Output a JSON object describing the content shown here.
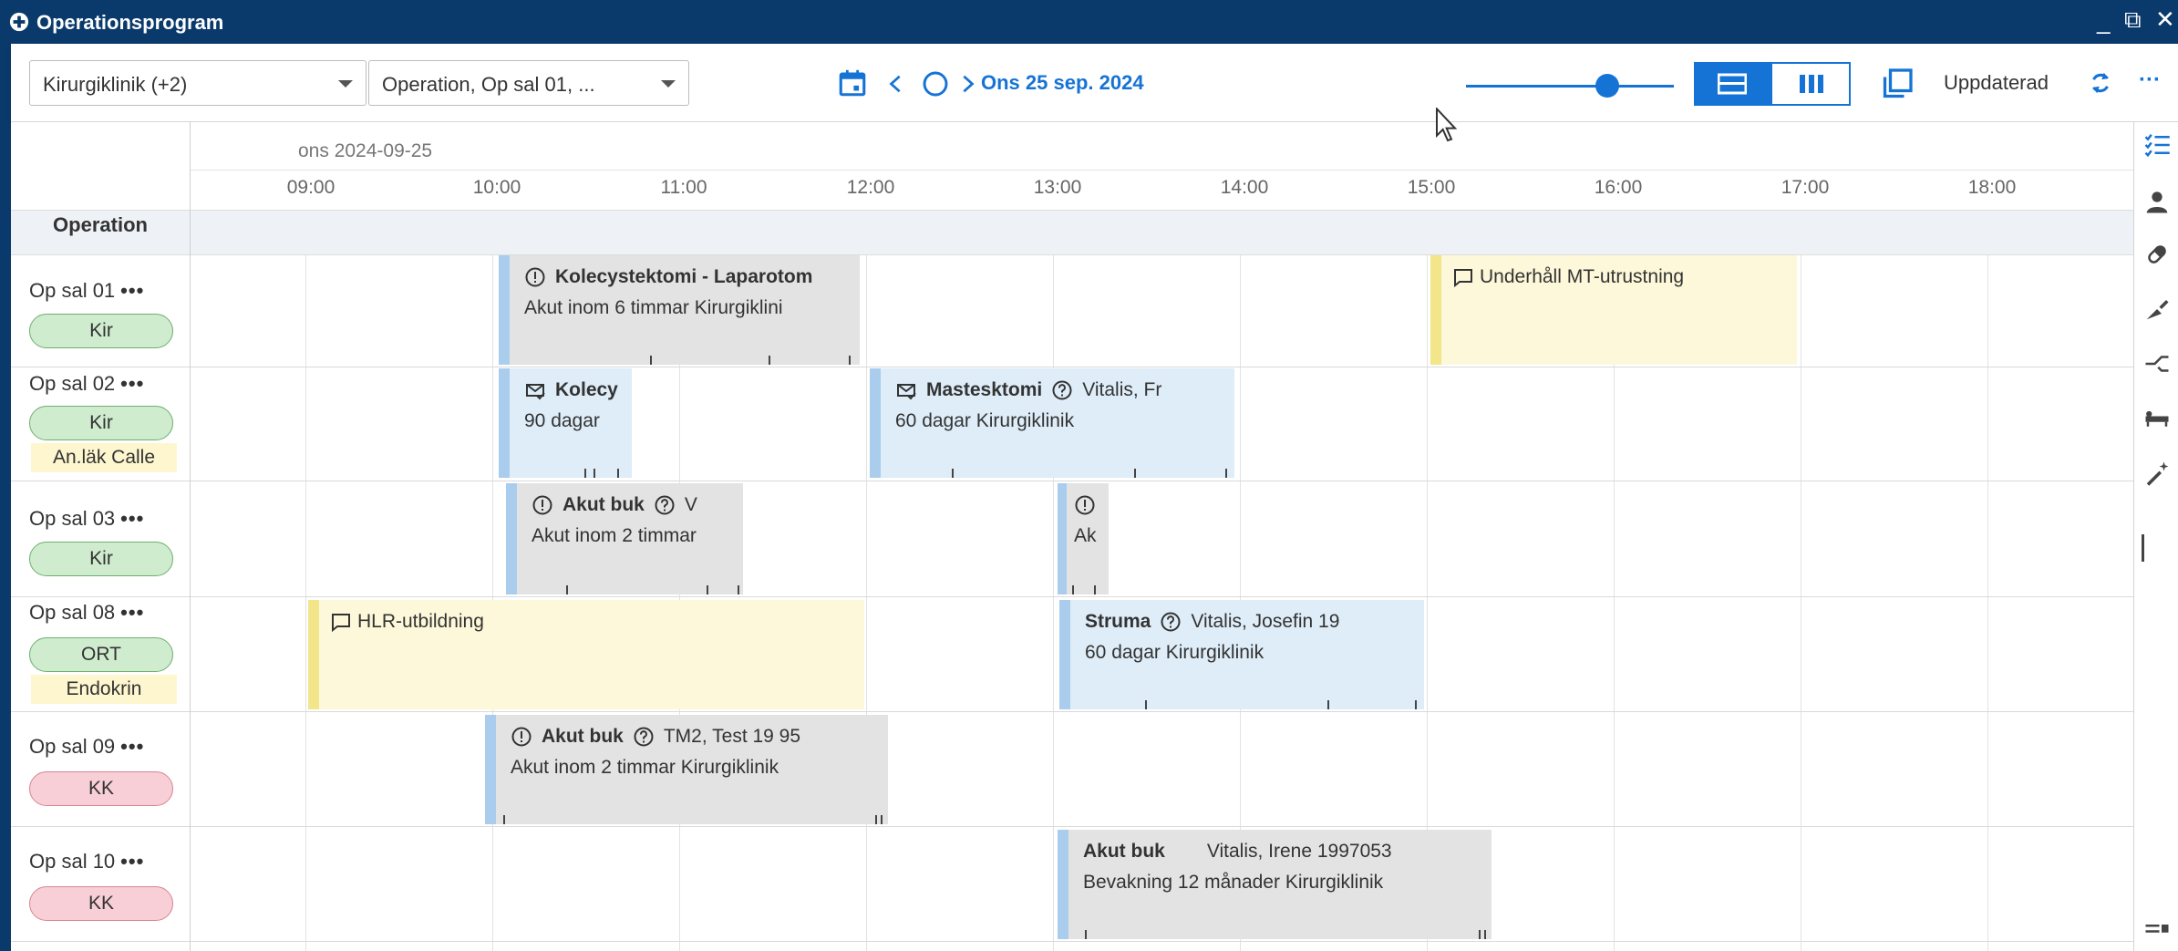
{
  "window": {
    "title": "Operationsprogram",
    "minimize": "_",
    "restore": "⧉",
    "close": "✕"
  },
  "toolbar": {
    "clinic_select": "Kirurgiklinik (+2)",
    "resource_select": "Operation, Op sal 01, ...",
    "date_label": "Ons 25 sep. 2024",
    "updated_label": "Uppdaterad",
    "more": "···"
  },
  "timeline": {
    "date_header": "ons 2024-09-25",
    "hours": [
      "09:00",
      "10:00",
      "11:00",
      "12:00",
      "13:00",
      "14:00",
      "15:00",
      "16:00",
      "17:00",
      "18:00"
    ],
    "row_header": "Operation"
  },
  "rooms": [
    {
      "name": "Op sal 01",
      "more": "•••",
      "pill": "Kir",
      "pill_color": "green"
    },
    {
      "name": "Op sal 02",
      "more": "•••",
      "pill": "Kir",
      "pill_color": "green",
      "sub": "An.läk Calle"
    },
    {
      "name": "Op sal 03",
      "more": "•••",
      "pill": "Kir",
      "pill_color": "green"
    },
    {
      "name": "Op sal 08",
      "more": "•••",
      "pill": "ORT",
      "pill_color": "green",
      "sub": "Endokrin"
    },
    {
      "name": "Op sal 09",
      "more": "•••",
      "pill": "KK",
      "pill_color": "red"
    },
    {
      "name": "Op sal 10",
      "more": "•••",
      "pill": "KK",
      "pill_color": "red"
    }
  ],
  "events": [
    {
      "title": "Kolecystektomi - Laparotom",
      "line2": "Akut inom 6 timmar  Kirurgiklini",
      "style": "grey",
      "icon": "alert-icon"
    },
    {
      "title": "Underhåll MT-utrustning",
      "style": "yellow",
      "icon": "comment-icon"
    },
    {
      "title": "Kolecy",
      "line2": "90 dagar",
      "style": "blue",
      "icon": "mail-check-icon"
    },
    {
      "title": "Mastesktomi",
      "extra": "Vitalis, Fr",
      "line2": "60 dagar  Kirurgiklinik",
      "style": "blue",
      "icon": "mail-check-icon"
    },
    {
      "title": "Akut buk",
      "extra": "V",
      "line2": "Akut inom 2 timmar",
      "style": "grey",
      "icon": "alert-icon"
    },
    {
      "title": "",
      "line2": "Ak",
      "style": "grey",
      "icon": "alert-icon"
    },
    {
      "title": "HLR-utbildning",
      "style": "yellow",
      "icon": "comment-icon"
    },
    {
      "title": "Struma",
      "extra": "Vitalis, Josefin  19",
      "line2": "60 dagar  Kirurgiklinik",
      "style": "blue"
    },
    {
      "title": "Akut buk",
      "extra": "TM2, Test  19 95",
      "line2": "Akut inom 2 timmar  Kirurgiklinik",
      "style": "grey",
      "icon": "alert-icon"
    },
    {
      "title": "Akut buk",
      "extra": "Vitalis, Irene  1997053",
      "line2": "Bevakning 12 månader  Kirurgiklinik",
      "style": "grey"
    }
  ],
  "colors": {
    "titlebar": "#0a3a6b",
    "accent": "#1673d6",
    "event_grey": "#e3e3e3",
    "event_blue": "#deedf8",
    "event_yellow": "#fdf8d9"
  }
}
